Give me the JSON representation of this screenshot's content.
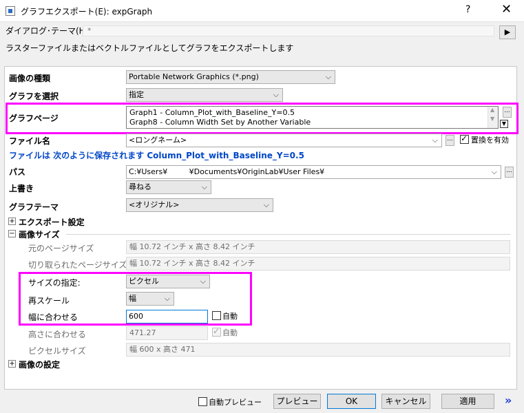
{
  "window": {
    "title": "グラフエクスポート(E): expGraph",
    "help": "?",
    "close": "✕"
  },
  "theme": {
    "label": "ダイアログ･テーマ(H)",
    "value": "*",
    "arrow": "▶"
  },
  "subtitle": "ラスターファイルまたはベクトルファイルとしてグラフをエクスポートします",
  "image_type": {
    "label": "画像の種類",
    "value": "Portable Network Graphics (*.png)"
  },
  "select_graph": {
    "label": "グラフを選択",
    "value": "指定"
  },
  "graph_page": {
    "label": "グラフページ",
    "items": [
      "Graph1 - Column_Plot_with_Baseline_Y=0.5",
      "Graph8 - Column Width Set by Another Variable"
    ],
    "ellipsis": "..."
  },
  "file_name": {
    "label": "ファイル名",
    "value": "<ロングネーム>",
    "ellipsis": "...",
    "replace_label": "置換を有効",
    "replace_checked": true
  },
  "save_note": "ファイルは 次のように保存されます Column_Plot_with_Baseline_Y=0.5",
  "path": {
    "label": "パス",
    "value": "C:¥Users¥         ¥Documents¥OriginLab¥User Files¥",
    "ellipsis": "..."
  },
  "overwrite": {
    "label": "上書き",
    "value": "尋ねる"
  },
  "graph_theme": {
    "label": "グラフテーマ",
    "value": "<オリジナル>"
  },
  "export_settings": {
    "label": "エクスポート設定",
    "toggle": "+"
  },
  "image_size": {
    "label": "画像サイズ",
    "toggle": "−",
    "original_label": "元のページサイズ",
    "original_value": "幅 10.72 インチ x 高さ 8.42 インチ",
    "cropped_label": "切り取られたページサイズ",
    "cropped_value": "幅 10.72 インチ x 高さ 8.42 インチ",
    "spec_label": "サイズの指定:",
    "spec_value": "ピクセル",
    "rescale_label": "再スケール",
    "rescale_value": "幅",
    "fit_width_label": "幅に合わせる",
    "fit_width_value": "600",
    "auto_label": "自動",
    "fit_height_label": "高さに合わせる",
    "fit_height_value": "471.27",
    "auto2_label": "自動",
    "pixel_size_label": "ピクセルサイズ",
    "pixel_size_value": "幅 600 x 高さ 471"
  },
  "image_settings": {
    "label": "画像の設定",
    "toggle": "+"
  },
  "footer": {
    "auto_preview": "自動プレビュー",
    "preview": "プレビュー",
    "ok": "OK",
    "cancel": "キャンセル",
    "apply": "適用",
    "more": "»"
  },
  "colors": {
    "highlight": "#ff00ff",
    "note_blue": "#0046c8",
    "default_button_border": "#0078d7"
  }
}
